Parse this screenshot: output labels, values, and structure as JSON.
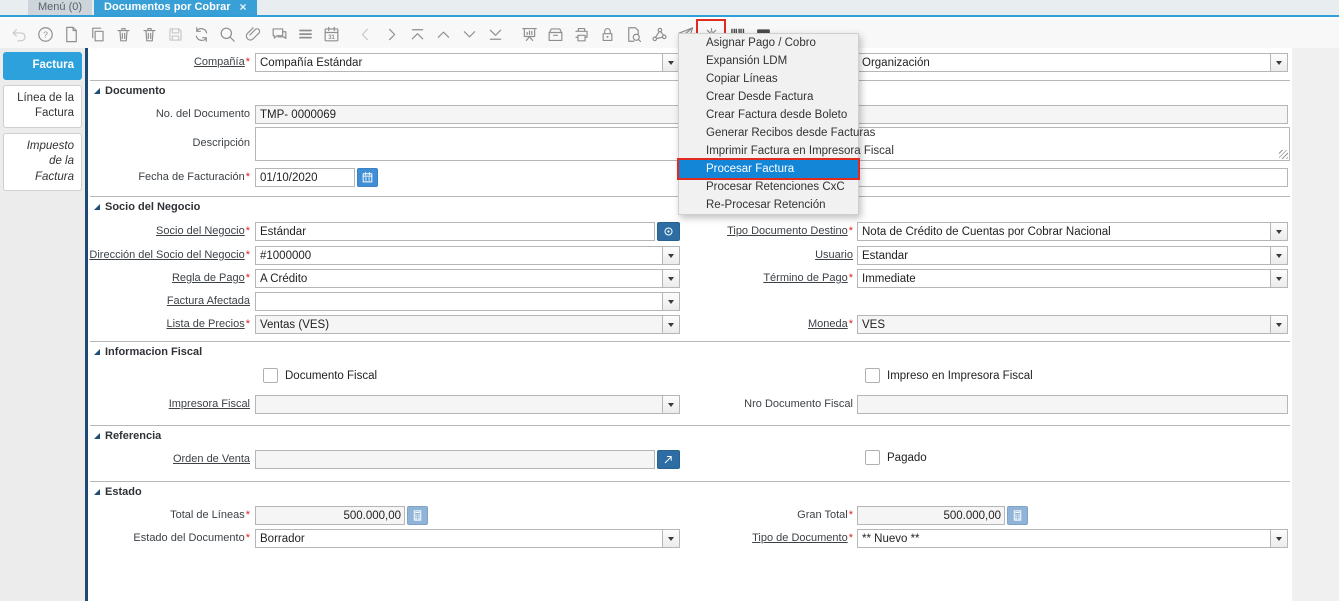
{
  "ui": {
    "required_marker": "*",
    "close_glyph": "×"
  },
  "colors": {
    "accent_blue": "#38a0d6",
    "selection_blue": "#1486d8",
    "highlight_red": "#e02b20",
    "button_blue": "#2e6da4"
  },
  "tab_bar": {
    "tabs": [
      {
        "label": "Menú (0)",
        "active": false
      },
      {
        "label": "Documentos por Cobrar",
        "active": true
      }
    ]
  },
  "toolbar": {
    "icons": [
      {
        "name": "undo-icon",
        "disabled": true
      },
      {
        "name": "help-icon"
      },
      {
        "name": "new-record-icon"
      },
      {
        "name": "copy-record-icon"
      },
      {
        "name": "delete-record-icon"
      },
      {
        "name": "delete-selection-icon"
      },
      {
        "name": "save-icon",
        "disabled": true
      },
      {
        "name": "refresh-icon"
      },
      {
        "name": "find-icon"
      },
      {
        "name": "attachment-icon"
      },
      {
        "name": "chat-icon"
      },
      {
        "name": "grid-toggle-icon"
      },
      {
        "name": "calendar-icon"
      },
      {
        "name": "previous-record-icon",
        "disabled": true,
        "group_start": true
      },
      {
        "name": "next-record-icon"
      },
      {
        "name": "first-record-icon"
      },
      {
        "name": "parent-record-icon"
      },
      {
        "name": "detail-record-icon"
      },
      {
        "name": "last-record-icon"
      },
      {
        "name": "report-icon",
        "group_start": true
      },
      {
        "name": "archive-icon"
      },
      {
        "name": "print-icon"
      },
      {
        "name": "lock-icon"
      },
      {
        "name": "print-preview-icon"
      },
      {
        "name": "workflow-icon"
      },
      {
        "name": "send-icon"
      },
      {
        "name": "process-icon",
        "highlighted": true
      },
      {
        "name": "export-icon",
        "dark": true
      },
      {
        "name": "screen-icon",
        "dark": true
      }
    ]
  },
  "sidebar": {
    "tabs": [
      {
        "name": "sidebar-tab-factura",
        "label": "Factura",
        "active": true
      },
      {
        "name": "sidebar-tab-linea-factura",
        "label": "Línea de la Factura"
      },
      {
        "name": "sidebar-tab-impuesto-factura",
        "label": "Impuesto de la Factura",
        "italic": true
      }
    ]
  },
  "sections": {
    "documento": "Documento",
    "socio": "Socio del Negocio",
    "fiscal": "Informacion Fiscal",
    "referencia": "Referencia",
    "estado": "Estado"
  },
  "form": {
    "compania": {
      "label": "Compañía",
      "value": "Compañía Estándar"
    },
    "organizacion": {
      "value": "Organización"
    },
    "no_documento": {
      "label": "No. del Documento",
      "value": "TMP- 0000069"
    },
    "doc_right_field": {
      "value": ""
    },
    "descripcion": {
      "label": "Descripción",
      "value": ""
    },
    "fecha_facturacion": {
      "label": "Fecha de Facturación",
      "value": "01/10/2020"
    },
    "fecha_right_field": {
      "value": ""
    },
    "socio_negocio": {
      "label": "Socio del Negocio",
      "value": "Estándar"
    },
    "tipo_doc_destino": {
      "label": "Tipo Documento Destino",
      "value": "Nota de Crédito de Cuentas por Cobrar Nacional"
    },
    "direccion_socio": {
      "label": "Dirección del Socio del Negocio",
      "value": "#1000000"
    },
    "usuario": {
      "label": "Usuario",
      "value": "Estandar"
    },
    "regla_pago": {
      "label": "Regla de Pago",
      "value": "A Crédito"
    },
    "termino_pago": {
      "label": "Término de Pago",
      "value": "Immediate"
    },
    "factura_afectada": {
      "label": "Factura Afectada",
      "value": ""
    },
    "lista_precios": {
      "label": "Lista de Precios",
      "value": "Ventas (VES)"
    },
    "moneda": {
      "label": "Moneda",
      "value": "VES"
    },
    "documento_fiscal": {
      "label": "Documento Fiscal"
    },
    "impreso_impresora": {
      "label": "Impreso en Impresora Fiscal"
    },
    "impresora_fiscal": {
      "label": "Impresora Fiscal",
      "value": ""
    },
    "nro_doc_fiscal": {
      "label": "Nro Documento Fiscal",
      "value": ""
    },
    "orden_venta": {
      "label": "Orden de Venta",
      "value": ""
    },
    "pagado": {
      "label": "Pagado"
    },
    "total_lineas": {
      "label": "Total de Líneas",
      "value": "500.000,00"
    },
    "gran_total": {
      "label": "Gran Total",
      "value": "500.000,00"
    },
    "estado_documento": {
      "label": "Estado del Documento",
      "value": "Borrador"
    },
    "tipo_documento": {
      "label": "Tipo de Documento",
      "value": "** Nuevo **"
    }
  },
  "process_menu": {
    "items": [
      {
        "label": "Asignar Pago / Cobro"
      },
      {
        "label": "Expansión LDM"
      },
      {
        "label": "Copiar Líneas"
      },
      {
        "label": "Crear Desde Factura"
      },
      {
        "label": "Crear Factura desde Boleto"
      },
      {
        "label": "Generar Recibos desde Facturas"
      },
      {
        "label": "Imprimir Factura en Impresora Fiscal"
      },
      {
        "label": "Procesar Factura",
        "selected": true
      },
      {
        "label": "Procesar Retenciones CxC"
      },
      {
        "label": "Re-Procesar Retención"
      }
    ]
  }
}
